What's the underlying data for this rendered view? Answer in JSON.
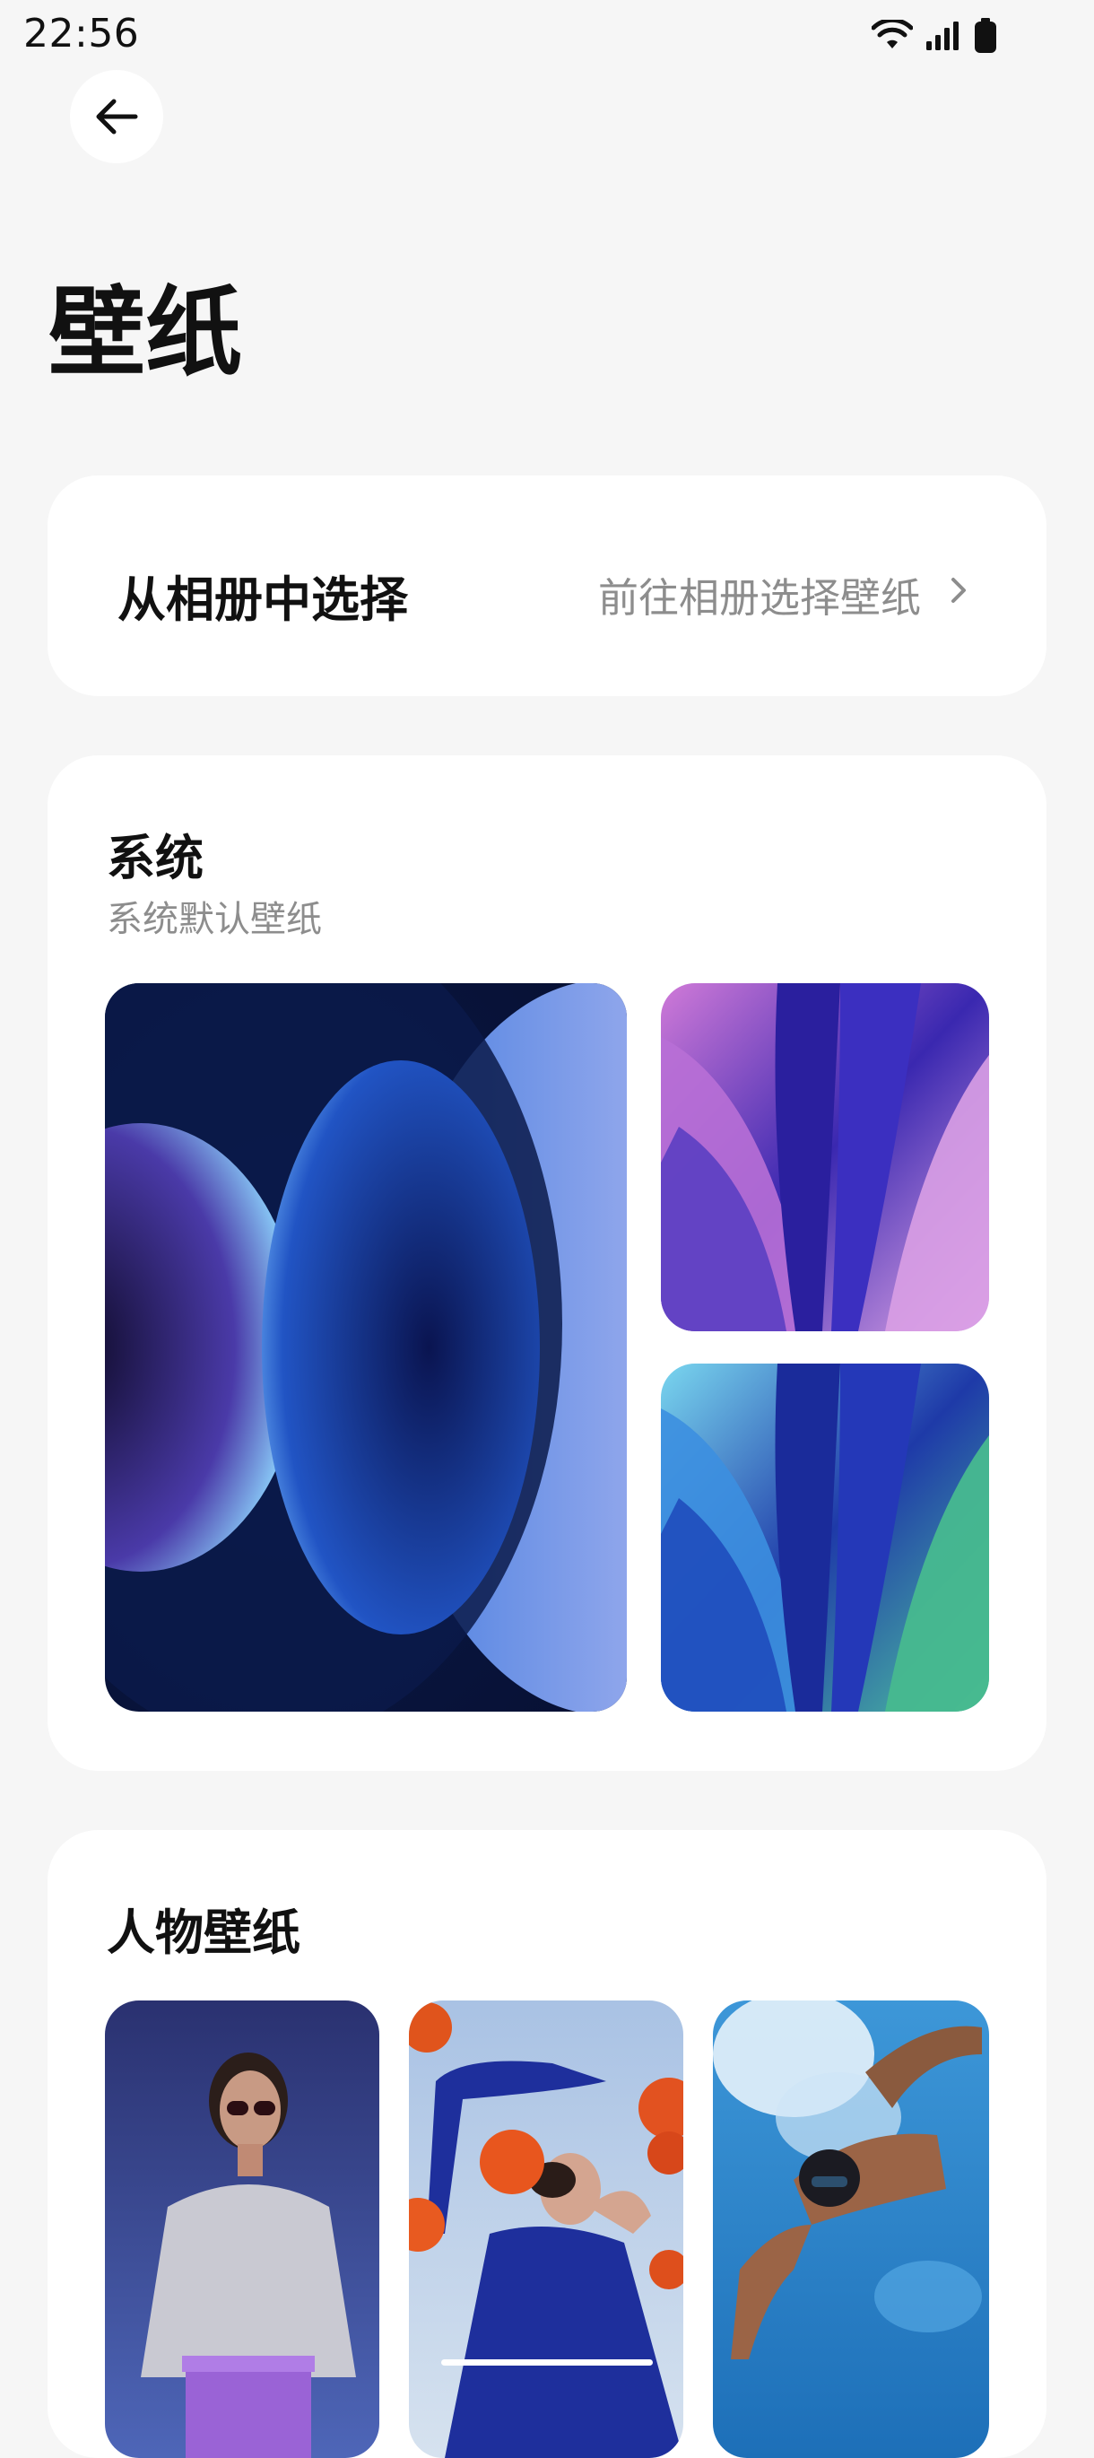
{
  "status_bar": {
    "time": "22:56",
    "icons": [
      "wifi-icon",
      "cellular-signal-icon",
      "battery-icon"
    ]
  },
  "header": {
    "back_icon": "arrow-left-icon",
    "title": "壁纸"
  },
  "album": {
    "label": "从相册中选择",
    "link_text": "前往相册选择壁纸",
    "chevron_icon": "chevron-right-icon"
  },
  "system_section": {
    "title": "系统",
    "subtitle": "系统默认壁纸",
    "wallpapers": [
      "blue-orbs-wallpaper",
      "purple-petals-wallpaper",
      "teal-petals-wallpaper"
    ]
  },
  "people_section": {
    "title": "人物壁纸",
    "wallpapers": [
      "woman-sunglasses-photo",
      "woman-poppies-photo",
      "swimmer-photo"
    ]
  },
  "colors": {
    "background": "#f6f6f6",
    "card": "#ffffff",
    "secondary_text": "#8d8d8d"
  }
}
